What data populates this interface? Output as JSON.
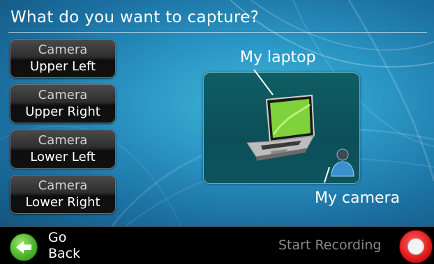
{
  "title": "What do you want to capture?",
  "cameras": [
    {
      "line1": "Camera",
      "line2": "Upper Left"
    },
    {
      "line1": "Camera",
      "line2": "Upper Right"
    },
    {
      "line1": "Camera",
      "line2": "Lower Left"
    },
    {
      "line1": "Camera",
      "line2": "Lower Right"
    }
  ],
  "preview": {
    "laptop_label": "My laptop",
    "camera_label": "My camera"
  },
  "footer": {
    "go_back_line1": "Go",
    "go_back_line2": "Back",
    "start_recording": "Start Recording"
  },
  "colors": {
    "accent_green": "#4fb52a",
    "record_red": "#e01a1a",
    "background": "#2a95c4"
  },
  "icons": {
    "back": "back-arrow-icon",
    "record": "record-icon",
    "laptop": "laptop-icon",
    "user": "user-icon"
  }
}
